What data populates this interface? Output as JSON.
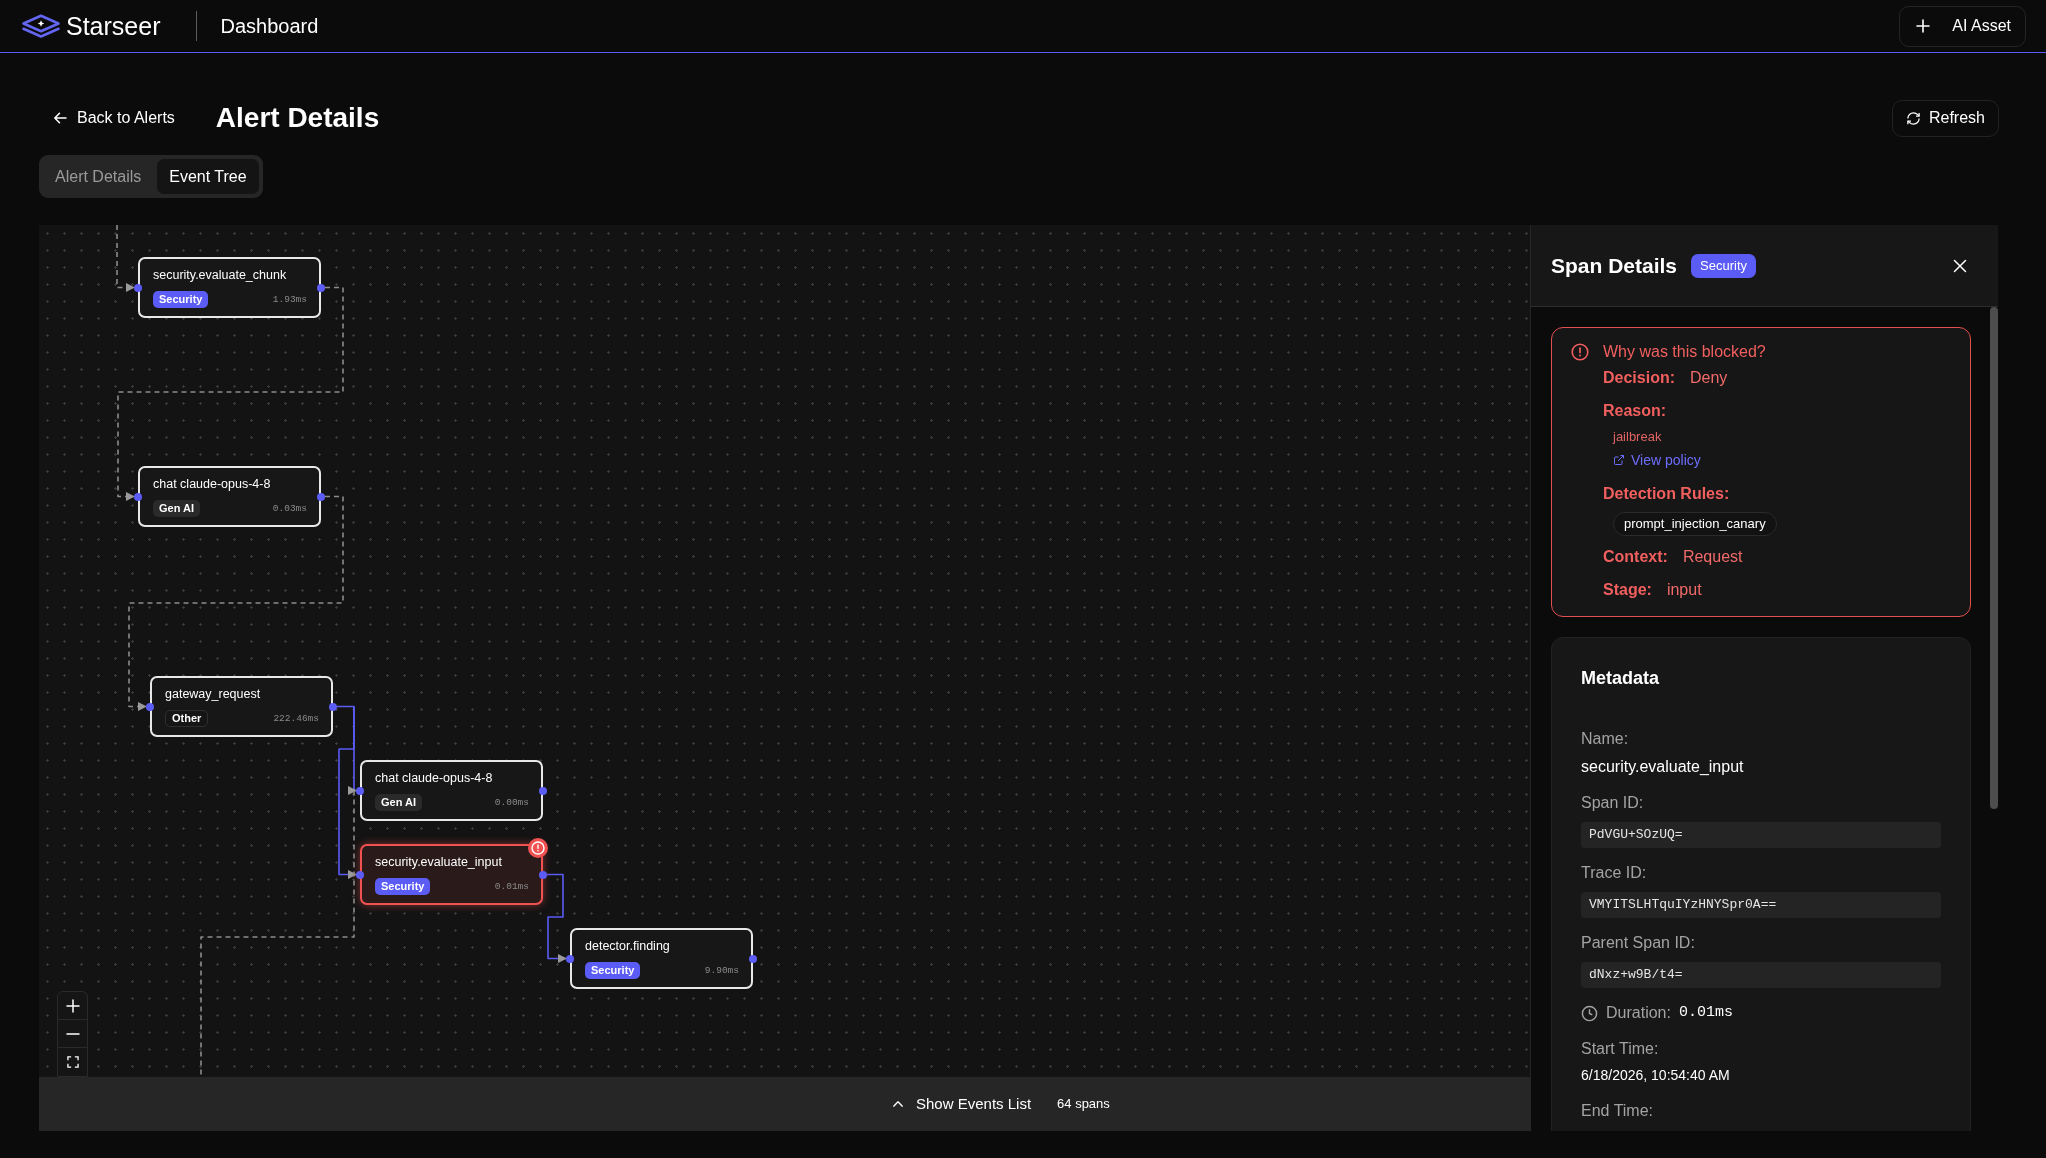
{
  "app": {
    "brand": "Starseer",
    "section": "Dashboard",
    "add_button": "AI Asset"
  },
  "header": {
    "back_link": "Back to Alerts",
    "title": "Alert Details",
    "refresh_button": "Refresh"
  },
  "tabs": [
    {
      "label": "Alert Details",
      "selected": false
    },
    {
      "label": "Event Tree",
      "selected": true
    }
  ],
  "event_tree": {
    "nodes": [
      {
        "name": "security.evaluate_chunk",
        "kind": "security",
        "category": "Security",
        "duration": "1.93ms",
        "blocked": false
      },
      {
        "name": "chat claude-opus-4-8",
        "kind": "genai",
        "category": "Gen AI",
        "duration": "0.03ms",
        "blocked": false
      },
      {
        "name": "gateway_request",
        "kind": "other",
        "category": "Other",
        "duration": "222.46ms",
        "blocked": false
      },
      {
        "name": "chat claude-opus-4-8",
        "kind": "genai",
        "category": "Gen AI",
        "duration": "0.00ms",
        "blocked": false
      },
      {
        "name": "security.evaluate_input",
        "kind": "security",
        "category": "Security",
        "duration": "0.01ms",
        "blocked": true
      },
      {
        "name": "detector.finding",
        "kind": "security",
        "category": "Security",
        "duration": "9.90ms",
        "blocked": false
      }
    ],
    "footer": {
      "toggle": "Show Events List",
      "span_count": "64 spans"
    }
  },
  "span_details": {
    "title": "Span Details",
    "category": "Security",
    "block_info": {
      "heading": "Why was this blocked?",
      "decision": {
        "label": "Decision:",
        "value": "Deny"
      },
      "reason": {
        "label": "Reason:",
        "value": "jailbreak",
        "link": "View policy"
      },
      "detection_rules": {
        "label": "Detection Rules:",
        "rules": [
          "prompt_injection_canary"
        ]
      },
      "context": {
        "label": "Context:",
        "value": "Request"
      },
      "stage": {
        "label": "Stage:",
        "value": "input"
      }
    },
    "metadata": {
      "title": "Metadata",
      "fields": [
        {
          "kind": "text",
          "label": "Name:",
          "value": "security.evaluate_input"
        },
        {
          "kind": "code",
          "label": "Span ID:",
          "value": "PdVGU+SOzUQ="
        },
        {
          "kind": "code",
          "label": "Trace ID:",
          "value": "VMYITSLHTquIYzHNYSpr0A=="
        },
        {
          "kind": "code",
          "label": "Parent Span ID:",
          "value": "dNxz+w9B/t4="
        },
        {
          "kind": "duration",
          "label": "Duration:",
          "value": "0.01ms"
        },
        {
          "kind": "timestamp",
          "label": "Start Time:",
          "value": "6/18/2026, 10:54:40 AM"
        },
        {
          "kind": "timestamp",
          "label": "End Time:"
        }
      ]
    }
  }
}
